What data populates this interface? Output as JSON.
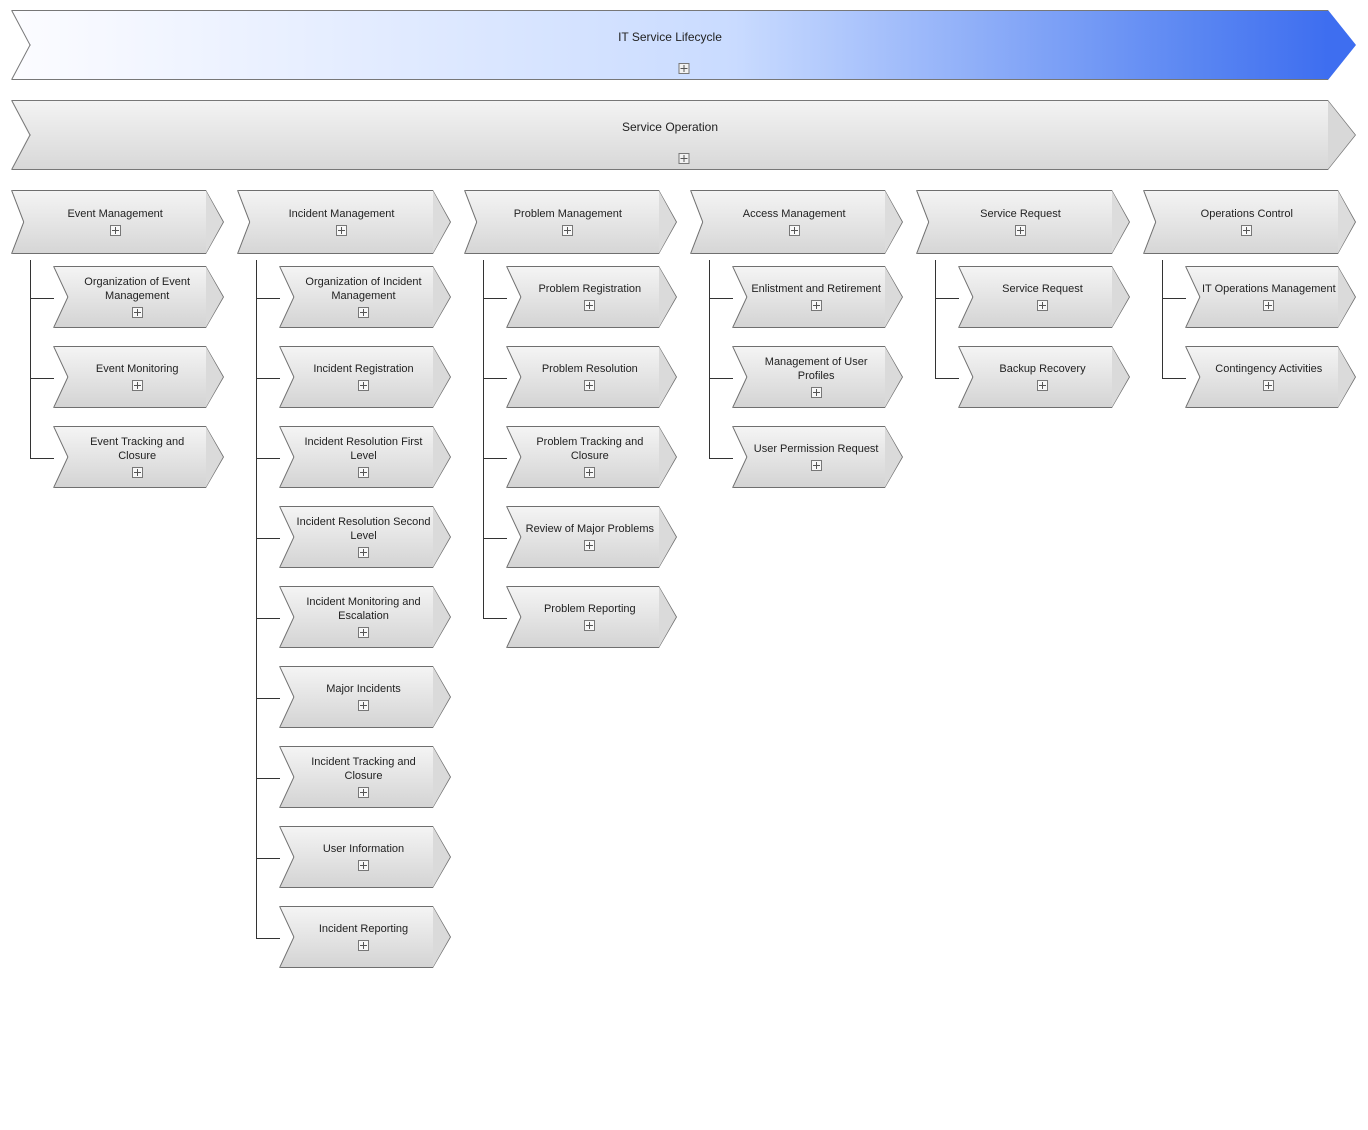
{
  "top1": "IT Service Lifecycle",
  "top2": "Service Operation",
  "cols": [
    {
      "title": "Event Management",
      "children": [
        {
          "t": "Organization of Event Management",
          "p": true
        },
        {
          "t": "Event Monitoring",
          "p": true
        },
        {
          "t": "Event Tracking and Closure",
          "p": true
        }
      ]
    },
    {
      "title": "Incident Management",
      "children": [
        {
          "t": "Organization of Incident Management",
          "p": true
        },
        {
          "t": "Incident Registration",
          "p": true
        },
        {
          "t": "Incident Resolution First Level",
          "p": true
        },
        {
          "t": "Incident Resolution Second Level",
          "p": true
        },
        {
          "t": "Incident Monitoring and Escalation",
          "p": true
        },
        {
          "t": "Major Incidents",
          "p": true
        },
        {
          "t": "Incident Tracking and Closure",
          "p": true
        },
        {
          "t": "User Information",
          "p": true
        },
        {
          "t": "Incident Reporting",
          "p": true
        }
      ]
    },
    {
      "title": "Problem Management",
      "children": [
        {
          "t": "Problem Registration",
          "p": true
        },
        {
          "t": "Problem Resolution",
          "p": true
        },
        {
          "t": "Problem Tracking and Closure",
          "p": true
        },
        {
          "t": "Review of Major Problems",
          "p": true
        },
        {
          "t": "Problem Reporting",
          "p": true
        }
      ]
    },
    {
      "title": "Access Management",
      "children": [
        {
          "t": "Enlistment and Retirement",
          "p": true
        },
        {
          "t": "Management of User Profiles",
          "p": true
        },
        {
          "t": "User Permission Request",
          "p": true
        }
      ]
    },
    {
      "title": "Service Request",
      "children": [
        {
          "t": "Service Request",
          "p": true
        },
        {
          "t": "Backup Recovery",
          "p": true
        }
      ]
    },
    {
      "title": "Operations Control",
      "children": [
        {
          "t": "IT Operations Management",
          "p": true
        },
        {
          "t": "Contingency Activities",
          "p": true
        }
      ]
    }
  ]
}
